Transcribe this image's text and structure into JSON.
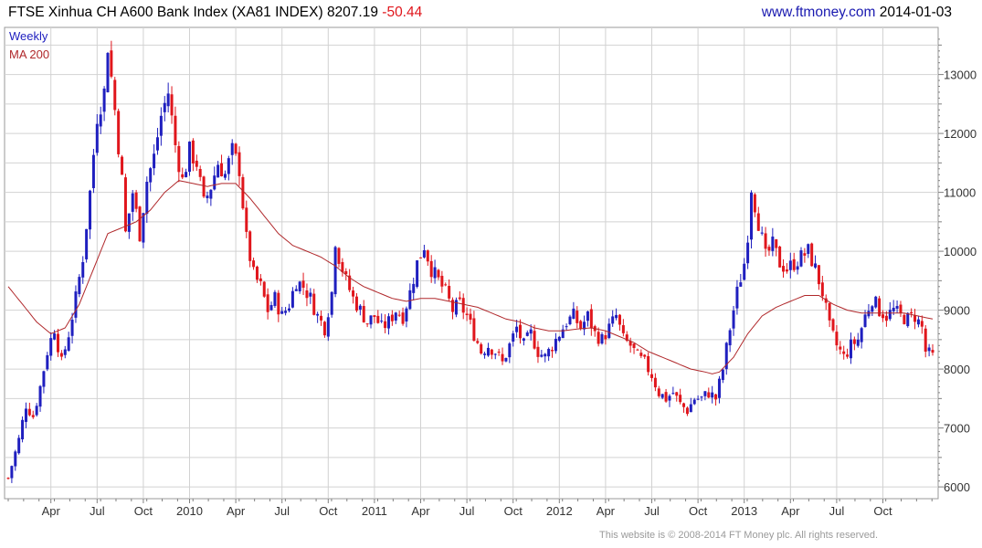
{
  "header": {
    "title": "FTSE Xinhua CH A600 Bank Index (XA81 INDEX)",
    "last": "8207.19",
    "change": "-50.44",
    "site": "www.ftmoney.com",
    "date": "2014-01-03"
  },
  "footer": "This website is © 2008-2014 FT Money plc. All rights reserved.",
  "colors": {
    "up": "#1f1fbf",
    "down": "#e0161c",
    "ma": "#b0282b",
    "grid": "#d2d2d2",
    "axis": "#808080"
  },
  "chart_data": {
    "type": "candlestick",
    "legend": [
      {
        "label": "Weekly",
        "color": "#1f1fbf"
      },
      {
        "label": "MA 200",
        "color": "#b0282b"
      }
    ],
    "ylim": [
      5800,
      13800
    ],
    "y_ticks": [
      6000,
      7000,
      8000,
      9000,
      10000,
      11000,
      12000,
      13000
    ],
    "x_ticks": [
      {
        "label": "Apr",
        "week": 12
      },
      {
        "label": "Jul",
        "week": 25
      },
      {
        "label": "Oct",
        "week": 38
      },
      {
        "label": "2010",
        "week": 51
      },
      {
        "label": "Apr",
        "week": 64
      },
      {
        "label": "Jul",
        "week": 77
      },
      {
        "label": "Oct",
        "week": 90
      },
      {
        "label": "2011",
        "week": 103
      },
      {
        "label": "Apr",
        "week": 116
      },
      {
        "label": "Jul",
        "week": 129
      },
      {
        "label": "Oct",
        "week": 142
      },
      {
        "label": "2012",
        "week": 155
      },
      {
        "label": "Apr",
        "week": 168
      },
      {
        "label": "Jul",
        "week": 181
      },
      {
        "label": "Oct",
        "week": 194
      },
      {
        "label": "2013",
        "week": 207
      },
      {
        "label": "Apr",
        "week": 220
      },
      {
        "label": "Jul",
        "week": 233
      },
      {
        "label": "Oct",
        "week": 246
      }
    ],
    "weeks": 261,
    "close_anchors": [
      [
        0,
        6150
      ],
      [
        3,
        6800
      ],
      [
        5,
        7400
      ],
      [
        7,
        7200
      ],
      [
        9,
        7700
      ],
      [
        11,
        8300
      ],
      [
        13,
        8700
      ],
      [
        15,
        8100
      ],
      [
        17,
        8600
      ],
      [
        19,
        9200
      ],
      [
        21,
        9900
      ],
      [
        23,
        11000
      ],
      [
        25,
        12300
      ],
      [
        27,
        12700
      ],
      [
        28,
        13500
      ],
      [
        30,
        12400
      ],
      [
        32,
        11200
      ],
      [
        33,
        10300
      ],
      [
        35,
        11000
      ],
      [
        37,
        10300
      ],
      [
        39,
        11200
      ],
      [
        41,
        11600
      ],
      [
        43,
        12300
      ],
      [
        45,
        12700
      ],
      [
        47,
        11800
      ],
      [
        49,
        11200
      ],
      [
        51,
        11700
      ],
      [
        53,
        11500
      ],
      [
        55,
        10800
      ],
      [
        57,
        11100
      ],
      [
        59,
        11500
      ],
      [
        61,
        11300
      ],
      [
        63,
        11700
      ],
      [
        65,
        11400
      ],
      [
        67,
        10200
      ],
      [
        69,
        9600
      ],
      [
        71,
        9400
      ],
      [
        73,
        9000
      ],
      [
        75,
        9200
      ],
      [
        77,
        8900
      ],
      [
        79,
        9100
      ],
      [
        81,
        9500
      ],
      [
        83,
        9400
      ],
      [
        85,
        9200
      ],
      [
        87,
        8900
      ],
      [
        89,
        8700
      ],
      [
        91,
        9300
      ],
      [
        92,
        10200
      ],
      [
        93,
        9900
      ],
      [
        95,
        9500
      ],
      [
        97,
        9200
      ],
      [
        99,
        9000
      ],
      [
        101,
        8800
      ],
      [
        103,
        8900
      ],
      [
        105,
        8700
      ],
      [
        107,
        8800
      ],
      [
        109,
        9000
      ],
      [
        111,
        8900
      ],
      [
        113,
        9300
      ],
      [
        115,
        9800
      ],
      [
        117,
        10100
      ],
      [
        119,
        9700
      ],
      [
        121,
        9500
      ],
      [
        123,
        9300
      ],
      [
        125,
        9000
      ],
      [
        127,
        9100
      ],
      [
        129,
        8900
      ],
      [
        131,
        8600
      ],
      [
        133,
        8300
      ],
      [
        135,
        8400
      ],
      [
        137,
        8300
      ],
      [
        139,
        8100
      ],
      [
        141,
        8400
      ],
      [
        143,
        8700
      ],
      [
        145,
        8400
      ],
      [
        147,
        8600
      ],
      [
        149,
        8300
      ],
      [
        151,
        8200
      ],
      [
        153,
        8400
      ],
      [
        155,
        8600
      ],
      [
        157,
        8800
      ],
      [
        159,
        8900
      ],
      [
        161,
        8700
      ],
      [
        163,
        8900
      ],
      [
        165,
        8600
      ],
      [
        167,
        8500
      ],
      [
        169,
        8700
      ],
      [
        171,
        8900
      ],
      [
        173,
        8500
      ],
      [
        175,
        8400
      ],
      [
        177,
        8200
      ],
      [
        179,
        8100
      ],
      [
        181,
        7900
      ],
      [
        183,
        7600
      ],
      [
        185,
        7500
      ],
      [
        187,
        7600
      ],
      [
        189,
        7400
      ],
      [
        191,
        7300
      ],
      [
        193,
        7500
      ],
      [
        195,
        7500
      ],
      [
        197,
        7600
      ],
      [
        199,
        7500
      ],
      [
        201,
        8000
      ],
      [
        203,
        8700
      ],
      [
        205,
        9300
      ],
      [
        207,
        9800
      ],
      [
        208,
        10300
      ],
      [
        209,
        11100
      ],
      [
        211,
        10500
      ],
      [
        213,
        9900
      ],
      [
        215,
        10100
      ],
      [
        217,
        9800
      ],
      [
        219,
        9700
      ],
      [
        221,
        9800
      ],
      [
        223,
        9900
      ],
      [
        225,
        10000
      ],
      [
        227,
        9700
      ],
      [
        229,
        9300
      ],
      [
        231,
        8700
      ],
      [
        233,
        8400
      ],
      [
        235,
        8200
      ],
      [
        237,
        8400
      ],
      [
        239,
        8500
      ],
      [
        241,
        8900
      ],
      [
        243,
        9200
      ],
      [
        245,
        9000
      ],
      [
        247,
        8900
      ],
      [
        249,
        9000
      ],
      [
        251,
        8900
      ],
      [
        253,
        8850
      ],
      [
        255,
        8900
      ],
      [
        257,
        8700
      ],
      [
        258,
        8300
      ],
      [
        259,
        8250
      ],
      [
        260,
        8207
      ]
    ],
    "ma200_anchors": [
      [
        0,
        9400
      ],
      [
        4,
        9100
      ],
      [
        8,
        8800
      ],
      [
        12,
        8600
      ],
      [
        16,
        8700
      ],
      [
        20,
        9100
      ],
      [
        24,
        9700
      ],
      [
        28,
        10300
      ],
      [
        32,
        10400
      ],
      [
        36,
        10500
      ],
      [
        40,
        10700
      ],
      [
        44,
        11000
      ],
      [
        48,
        11200
      ],
      [
        52,
        11150
      ],
      [
        56,
        11100
      ],
      [
        60,
        11150
      ],
      [
        64,
        11150
      ],
      [
        68,
        10900
      ],
      [
        72,
        10600
      ],
      [
        76,
        10300
      ],
      [
        80,
        10100
      ],
      [
        84,
        10000
      ],
      [
        88,
        9900
      ],
      [
        92,
        9750
      ],
      [
        96,
        9550
      ],
      [
        100,
        9400
      ],
      [
        104,
        9300
      ],
      [
        108,
        9200
      ],
      [
        112,
        9150
      ],
      [
        116,
        9200
      ],
      [
        120,
        9200
      ],
      [
        124,
        9150
      ],
      [
        128,
        9100
      ],
      [
        132,
        9050
      ],
      [
        136,
        8950
      ],
      [
        140,
        8850
      ],
      [
        144,
        8800
      ],
      [
        148,
        8700
      ],
      [
        152,
        8650
      ],
      [
        156,
        8650
      ],
      [
        160,
        8680
      ],
      [
        164,
        8700
      ],
      [
        168,
        8650
      ],
      [
        172,
        8550
      ],
      [
        176,
        8450
      ],
      [
        180,
        8300
      ],
      [
        184,
        8200
      ],
      [
        188,
        8100
      ],
      [
        192,
        8000
      ],
      [
        196,
        7950
      ],
      [
        198,
        7920
      ],
      [
        200,
        7950
      ],
      [
        204,
        8200
      ],
      [
        208,
        8600
      ],
      [
        212,
        8900
      ],
      [
        216,
        9050
      ],
      [
        220,
        9150
      ],
      [
        224,
        9250
      ],
      [
        228,
        9250
      ],
      [
        232,
        9100
      ],
      [
        236,
        9000
      ],
      [
        240,
        8950
      ],
      [
        244,
        8950
      ],
      [
        248,
        8950
      ],
      [
        252,
        8950
      ],
      [
        256,
        8900
      ],
      [
        260,
        8850
      ]
    ]
  }
}
